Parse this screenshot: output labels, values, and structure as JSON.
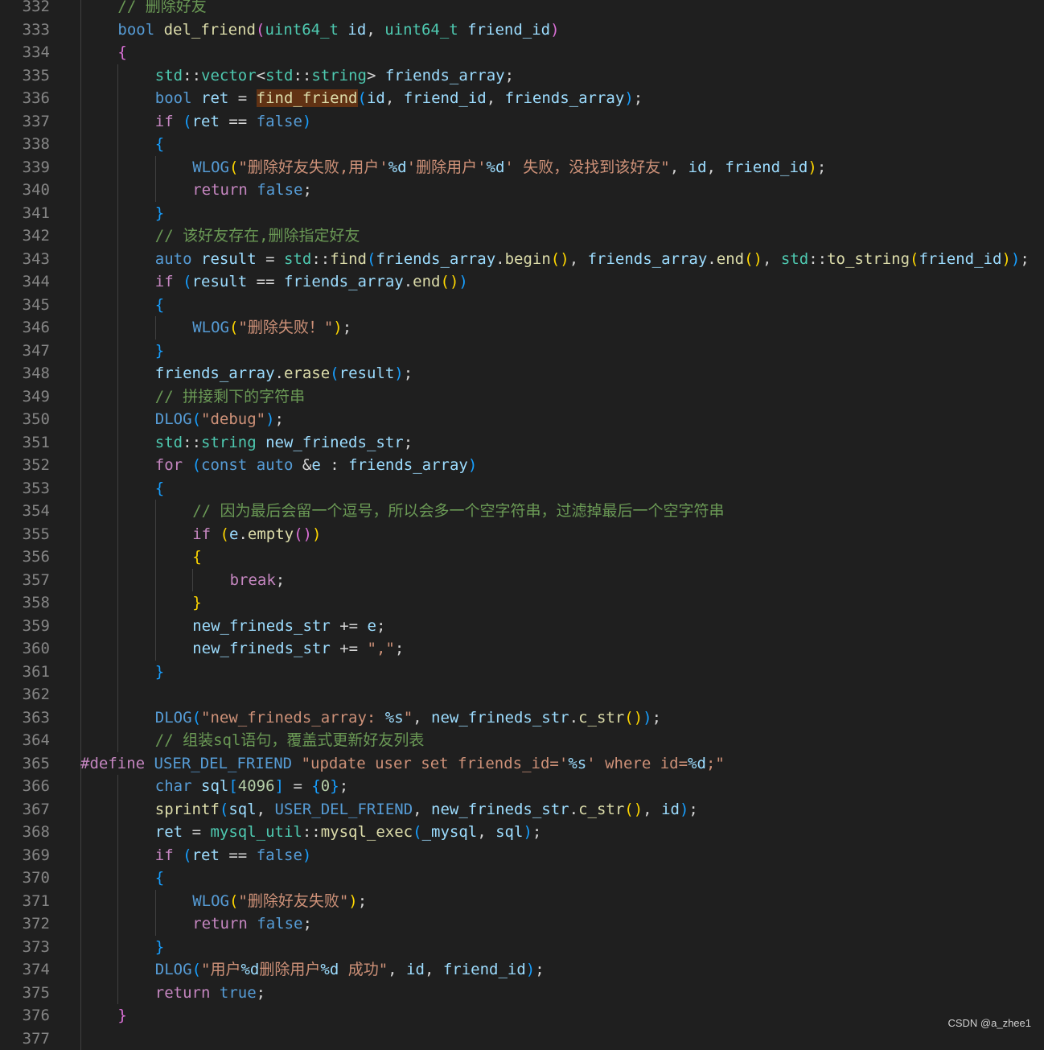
{
  "watermark": "CSDN @a_zhee1",
  "lines": [
    {
      "n": "332",
      "indent": 1,
      "t": [
        [
          "cmt",
          "// 删除好友"
        ]
      ]
    },
    {
      "n": "333",
      "indent": 1,
      "t": [
        [
          "kw",
          "bool"
        ],
        [
          "op",
          " "
        ],
        [
          "fn",
          "del_friend"
        ],
        [
          "b2",
          "("
        ],
        [
          "ty",
          "uint64_t"
        ],
        [
          "op",
          " "
        ],
        [
          "var",
          "id"
        ],
        [
          "op",
          ", "
        ],
        [
          "ty",
          "uint64_t"
        ],
        [
          "op",
          " "
        ],
        [
          "var",
          "friend_id"
        ],
        [
          "b2",
          ")"
        ]
      ]
    },
    {
      "n": "334",
      "indent": 1,
      "t": [
        [
          "b2",
          "{"
        ]
      ]
    },
    {
      "n": "335",
      "indent": 2,
      "t": [
        [
          "ns",
          "std"
        ],
        [
          "op",
          "::"
        ],
        [
          "ty",
          "vector"
        ],
        [
          "op",
          "<"
        ],
        [
          "ns",
          "std"
        ],
        [
          "op",
          "::"
        ],
        [
          "ty",
          "string"
        ],
        [
          "op",
          "> "
        ],
        [
          "var",
          "friends_array"
        ],
        [
          "op",
          ";"
        ]
      ]
    },
    {
      "n": "336",
      "indent": 2,
      "t": [
        [
          "kw",
          "bool"
        ],
        [
          "op",
          " "
        ],
        [
          "var",
          "ret"
        ],
        [
          "op",
          " = "
        ],
        [
          "hl",
          "find_friend"
        ],
        [
          "b3",
          "("
        ],
        [
          "var",
          "id"
        ],
        [
          "op",
          ", "
        ],
        [
          "var",
          "friend_id"
        ],
        [
          "op",
          ", "
        ],
        [
          "var",
          "friends_array"
        ],
        [
          "b3",
          ")"
        ],
        [
          "op",
          ";"
        ]
      ]
    },
    {
      "n": "337",
      "indent": 2,
      "t": [
        [
          "ctrl",
          "if"
        ],
        [
          "op",
          " "
        ],
        [
          "b3",
          "("
        ],
        [
          "var",
          "ret"
        ],
        [
          "op",
          " == "
        ],
        [
          "kw",
          "false"
        ],
        [
          "b3",
          ")"
        ]
      ]
    },
    {
      "n": "338",
      "indent": 2,
      "t": [
        [
          "b3",
          "{"
        ]
      ]
    },
    {
      "n": "339",
      "indent": 3,
      "t": [
        [
          "mac",
          "WLOG"
        ],
        [
          "b1",
          "("
        ],
        [
          "str",
          "\"删除好友失败,用户'"
        ],
        [
          "esc",
          "%d"
        ],
        [
          "str",
          "'删除用户'"
        ],
        [
          "esc",
          "%d"
        ],
        [
          "str",
          "' 失败，没找到该好友\""
        ],
        [
          "op",
          ", "
        ],
        [
          "var",
          "id"
        ],
        [
          "op",
          ", "
        ],
        [
          "var",
          "friend_id"
        ],
        [
          "b1",
          ")"
        ],
        [
          "op",
          ";"
        ]
      ]
    },
    {
      "n": "340",
      "indent": 3,
      "t": [
        [
          "ctrl",
          "return"
        ],
        [
          "op",
          " "
        ],
        [
          "kw",
          "false"
        ],
        [
          "op",
          ";"
        ]
      ]
    },
    {
      "n": "341",
      "indent": 2,
      "t": [
        [
          "b3",
          "}"
        ]
      ]
    },
    {
      "n": "342",
      "indent": 2,
      "t": [
        [
          "cmt",
          "// 该好友存在,删除指定好友"
        ]
      ]
    },
    {
      "n": "343",
      "indent": 2,
      "t": [
        [
          "kw",
          "auto"
        ],
        [
          "op",
          " "
        ],
        [
          "var",
          "result"
        ],
        [
          "op",
          " = "
        ],
        [
          "ns",
          "std"
        ],
        [
          "op",
          "::"
        ],
        [
          "fn",
          "find"
        ],
        [
          "b3",
          "("
        ],
        [
          "var",
          "friends_array"
        ],
        [
          "op",
          "."
        ],
        [
          "fn",
          "begin"
        ],
        [
          "b1",
          "()"
        ],
        [
          "op",
          ", "
        ],
        [
          "var",
          "friends_array"
        ],
        [
          "op",
          "."
        ],
        [
          "fn",
          "end"
        ],
        [
          "b1",
          "()"
        ],
        [
          "op",
          ", "
        ],
        [
          "ns",
          "std"
        ],
        [
          "op",
          "::"
        ],
        [
          "fn",
          "to_string"
        ],
        [
          "b1",
          "("
        ],
        [
          "var",
          "friend_id"
        ],
        [
          "b1",
          ")"
        ],
        [
          "b3",
          ")"
        ],
        [
          "op",
          ";"
        ]
      ]
    },
    {
      "n": "344",
      "indent": 2,
      "t": [
        [
          "ctrl",
          "if"
        ],
        [
          "op",
          " "
        ],
        [
          "b3",
          "("
        ],
        [
          "var",
          "result"
        ],
        [
          "op",
          " == "
        ],
        [
          "var",
          "friends_array"
        ],
        [
          "op",
          "."
        ],
        [
          "fn",
          "end"
        ],
        [
          "b1",
          "()"
        ],
        [
          "b3",
          ")"
        ]
      ]
    },
    {
      "n": "345",
      "indent": 2,
      "t": [
        [
          "b3",
          "{"
        ]
      ]
    },
    {
      "n": "346",
      "indent": 3,
      "t": [
        [
          "mac",
          "WLOG"
        ],
        [
          "b1",
          "("
        ],
        [
          "str",
          "\"删除失败！\""
        ],
        [
          "b1",
          ")"
        ],
        [
          "op",
          ";"
        ]
      ]
    },
    {
      "n": "347",
      "indent": 2,
      "t": [
        [
          "b3",
          "}"
        ]
      ]
    },
    {
      "n": "348",
      "indent": 2,
      "t": [
        [
          "var",
          "friends_array"
        ],
        [
          "op",
          "."
        ],
        [
          "fn",
          "erase"
        ],
        [
          "b3",
          "("
        ],
        [
          "var",
          "result"
        ],
        [
          "b3",
          ")"
        ],
        [
          "op",
          ";"
        ]
      ]
    },
    {
      "n": "349",
      "indent": 2,
      "t": [
        [
          "cmt",
          "// 拼接剩下的字符串"
        ]
      ]
    },
    {
      "n": "350",
      "indent": 2,
      "t": [
        [
          "mac",
          "DLOG"
        ],
        [
          "b3",
          "("
        ],
        [
          "str",
          "\"debug\""
        ],
        [
          "b3",
          ")"
        ],
        [
          "op",
          ";"
        ]
      ]
    },
    {
      "n": "351",
      "indent": 2,
      "t": [
        [
          "ns",
          "std"
        ],
        [
          "op",
          "::"
        ],
        [
          "ty",
          "string"
        ],
        [
          "op",
          " "
        ],
        [
          "var",
          "new_frineds_str"
        ],
        [
          "op",
          ";"
        ]
      ]
    },
    {
      "n": "352",
      "indent": 2,
      "t": [
        [
          "ctrl",
          "for"
        ],
        [
          "op",
          " "
        ],
        [
          "b3",
          "("
        ],
        [
          "kw",
          "const"
        ],
        [
          "op",
          " "
        ],
        [
          "kw",
          "auto"
        ],
        [
          "op",
          " &"
        ],
        [
          "var",
          "e"
        ],
        [
          "op",
          " : "
        ],
        [
          "var",
          "friends_array"
        ],
        [
          "b3",
          ")"
        ]
      ]
    },
    {
      "n": "353",
      "indent": 2,
      "t": [
        [
          "b3",
          "{"
        ]
      ]
    },
    {
      "n": "354",
      "indent": 3,
      "t": [
        [
          "cmt",
          "// 因为最后会留一个逗号，所以会多一个空字符串，过滤掉最后一个空字符串"
        ]
      ]
    },
    {
      "n": "355",
      "indent": 3,
      "t": [
        [
          "ctrl",
          "if"
        ],
        [
          "op",
          " "
        ],
        [
          "b1",
          "("
        ],
        [
          "var",
          "e"
        ],
        [
          "op",
          "."
        ],
        [
          "fn",
          "empty"
        ],
        [
          "b2",
          "()"
        ],
        [
          "b1",
          ")"
        ]
      ]
    },
    {
      "n": "356",
      "indent": 3,
      "t": [
        [
          "b1",
          "{"
        ]
      ]
    },
    {
      "n": "357",
      "indent": 4,
      "t": [
        [
          "ctrl",
          "break"
        ],
        [
          "op",
          ";"
        ]
      ]
    },
    {
      "n": "358",
      "indent": 3,
      "t": [
        [
          "b1",
          "}"
        ]
      ]
    },
    {
      "n": "359",
      "indent": 3,
      "t": [
        [
          "var",
          "new_frineds_str"
        ],
        [
          "op",
          " += "
        ],
        [
          "var",
          "e"
        ],
        [
          "op",
          ";"
        ]
      ]
    },
    {
      "n": "360",
      "indent": 3,
      "t": [
        [
          "var",
          "new_frineds_str"
        ],
        [
          "op",
          " += "
        ],
        [
          "str",
          "\",\""
        ],
        [
          "op",
          ";"
        ]
      ]
    },
    {
      "n": "361",
      "indent": 2,
      "t": [
        [
          "b3",
          "}"
        ]
      ]
    },
    {
      "n": "362",
      "indent": 2,
      "t": []
    },
    {
      "n": "363",
      "indent": 2,
      "t": [
        [
          "mac",
          "DLOG"
        ],
        [
          "b3",
          "("
        ],
        [
          "str",
          "\"new_frineds_array: "
        ],
        [
          "esc",
          "%s"
        ],
        [
          "str",
          "\""
        ],
        [
          "op",
          ", "
        ],
        [
          "var",
          "new_frineds_str"
        ],
        [
          "op",
          "."
        ],
        [
          "fn",
          "c_str"
        ],
        [
          "b1",
          "()"
        ],
        [
          "b3",
          ")"
        ],
        [
          "op",
          ";"
        ]
      ]
    },
    {
      "n": "364",
      "indent": 2,
      "t": [
        [
          "cmt",
          "// 组装sql语句，覆盖式更新好友列表"
        ]
      ]
    },
    {
      "n": "365",
      "indent": 0,
      "t": [
        [
          "ctrl",
          "#define"
        ],
        [
          "op",
          " "
        ],
        [
          "mac",
          "USER_DEL_FRIEND"
        ],
        [
          "op",
          " "
        ],
        [
          "str",
          "\"update user set friends_id='"
        ],
        [
          "esc",
          "%s"
        ],
        [
          "str",
          "' where id="
        ],
        [
          "esc",
          "%d"
        ],
        [
          "str",
          ";\""
        ]
      ]
    },
    {
      "n": "366",
      "indent": 2,
      "t": [
        [
          "kw",
          "char"
        ],
        [
          "op",
          " "
        ],
        [
          "var",
          "sql"
        ],
        [
          "b3",
          "["
        ],
        [
          "num",
          "4096"
        ],
        [
          "b3",
          "]"
        ],
        [
          "op",
          " = "
        ],
        [
          "b3",
          "{"
        ],
        [
          "num",
          "0"
        ],
        [
          "b3",
          "}"
        ],
        [
          "op",
          ";"
        ]
      ]
    },
    {
      "n": "367",
      "indent": 2,
      "t": [
        [
          "fn",
          "sprintf"
        ],
        [
          "b3",
          "("
        ],
        [
          "var",
          "sql"
        ],
        [
          "op",
          ", "
        ],
        [
          "mac",
          "USER_DEL_FRIEND"
        ],
        [
          "op",
          ", "
        ],
        [
          "var",
          "new_frineds_str"
        ],
        [
          "op",
          "."
        ],
        [
          "fn",
          "c_str"
        ],
        [
          "b1",
          "()"
        ],
        [
          "op",
          ", "
        ],
        [
          "var",
          "id"
        ],
        [
          "b3",
          ")"
        ],
        [
          "op",
          ";"
        ]
      ]
    },
    {
      "n": "368",
      "indent": 2,
      "t": [
        [
          "var",
          "ret"
        ],
        [
          "op",
          " = "
        ],
        [
          "ns",
          "mysql_util"
        ],
        [
          "op",
          "::"
        ],
        [
          "fn",
          "mysql_exec"
        ],
        [
          "b3",
          "("
        ],
        [
          "var",
          "_mysql"
        ],
        [
          "op",
          ", "
        ],
        [
          "var",
          "sql"
        ],
        [
          "b3",
          ")"
        ],
        [
          "op",
          ";"
        ]
      ]
    },
    {
      "n": "369",
      "indent": 2,
      "t": [
        [
          "ctrl",
          "if"
        ],
        [
          "op",
          " "
        ],
        [
          "b3",
          "("
        ],
        [
          "var",
          "ret"
        ],
        [
          "op",
          " == "
        ],
        [
          "kw",
          "false"
        ],
        [
          "b3",
          ")"
        ]
      ]
    },
    {
      "n": "370",
      "indent": 2,
      "t": [
        [
          "b3",
          "{"
        ]
      ]
    },
    {
      "n": "371",
      "indent": 3,
      "t": [
        [
          "mac",
          "WLOG"
        ],
        [
          "b1",
          "("
        ],
        [
          "str",
          "\"删除好友失败\""
        ],
        [
          "b1",
          ")"
        ],
        [
          "op",
          ";"
        ]
      ]
    },
    {
      "n": "372",
      "indent": 3,
      "t": [
        [
          "ctrl",
          "return"
        ],
        [
          "op",
          " "
        ],
        [
          "kw",
          "false"
        ],
        [
          "op",
          ";"
        ]
      ]
    },
    {
      "n": "373",
      "indent": 2,
      "t": [
        [
          "b3",
          "}"
        ]
      ]
    },
    {
      "n": "374",
      "indent": 2,
      "t": [
        [
          "mac",
          "DLOG"
        ],
        [
          "b3",
          "("
        ],
        [
          "str",
          "\"用户"
        ],
        [
          "esc",
          "%d"
        ],
        [
          "str",
          "删除用户"
        ],
        [
          "esc",
          "%d"
        ],
        [
          "str",
          " 成功\""
        ],
        [
          "op",
          ", "
        ],
        [
          "var",
          "id"
        ],
        [
          "op",
          ", "
        ],
        [
          "var",
          "friend_id"
        ],
        [
          "b3",
          ")"
        ],
        [
          "op",
          ";"
        ]
      ]
    },
    {
      "n": "375",
      "indent": 2,
      "t": [
        [
          "ctrl",
          "return"
        ],
        [
          "op",
          " "
        ],
        [
          "kw",
          "true"
        ],
        [
          "op",
          ";"
        ]
      ]
    },
    {
      "n": "376",
      "indent": 1,
      "t": [
        [
          "b2",
          "}"
        ]
      ]
    },
    {
      "n": "377",
      "indent": 1,
      "t": []
    }
  ]
}
